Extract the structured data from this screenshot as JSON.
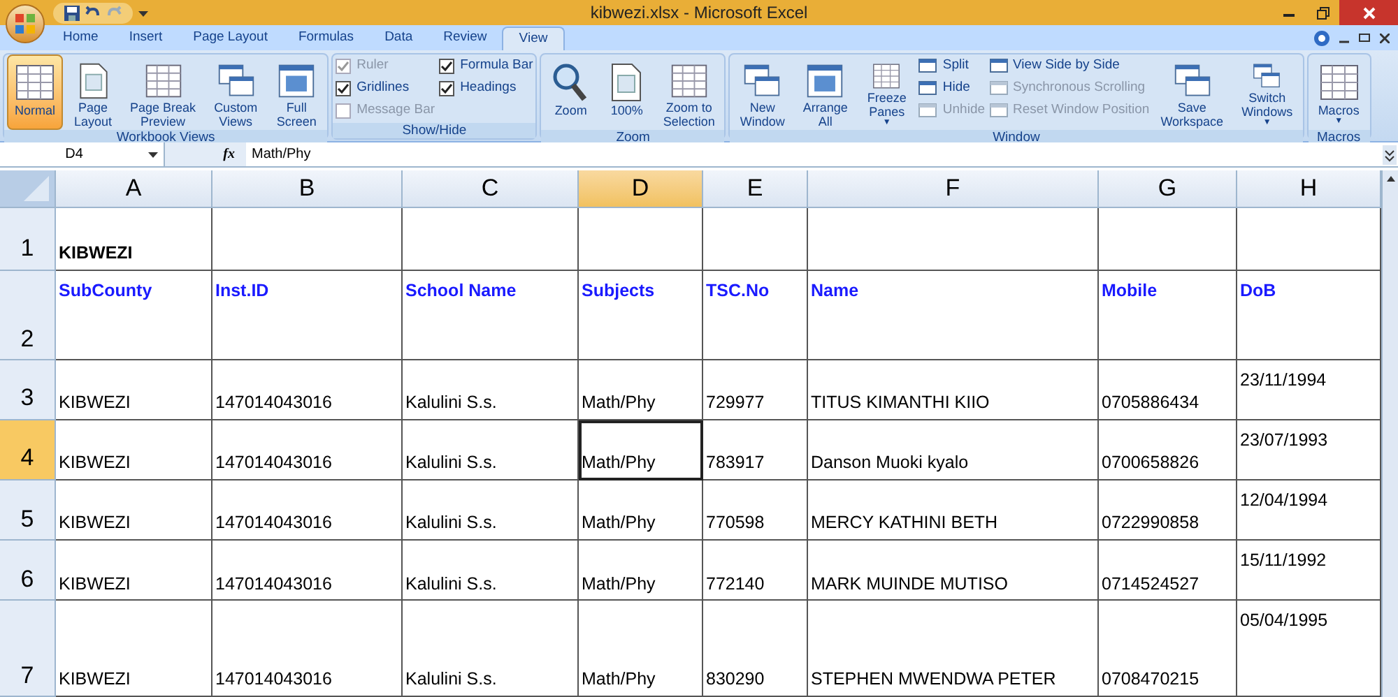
{
  "window": {
    "title": "kibwezi.xlsx - Microsoft Excel"
  },
  "tabs": [
    {
      "label": "Home",
      "selected": false
    },
    {
      "label": "Insert",
      "selected": false
    },
    {
      "label": "Page Layout",
      "selected": false
    },
    {
      "label": "Formulas",
      "selected": false
    },
    {
      "label": "Data",
      "selected": false
    },
    {
      "label": "Review",
      "selected": false
    },
    {
      "label": "View",
      "selected": true
    }
  ],
  "ribbon": {
    "groups": [
      {
        "label": "Workbook Views",
        "columns": [
          [
            {
              "kind": "large",
              "label": "Normal",
              "selected": true
            }
          ],
          [
            {
              "kind": "large",
              "label": "Page\nLayout",
              "selected": false
            }
          ],
          [
            {
              "kind": "large",
              "label": "Page Break\nPreview",
              "selected": false
            }
          ],
          [
            {
              "kind": "large",
              "label": "Custom\nViews",
              "selected": false
            }
          ],
          [
            {
              "kind": "large",
              "label": "Full\nScreen",
              "selected": false
            }
          ]
        ]
      },
      {
        "label": "Show/Hide",
        "columns": [
          [
            {
              "kind": "check",
              "label": "Ruler",
              "checked": true,
              "disabled": true
            },
            {
              "kind": "check",
              "label": "Gridlines",
              "checked": true,
              "disabled": false
            },
            {
              "kind": "check",
              "label": "Message Bar",
              "checked": false,
              "disabled": true
            }
          ],
          [
            {
              "kind": "check",
              "label": "Formula Bar",
              "checked": true,
              "disabled": false
            },
            {
              "kind": "check",
              "label": "Headings",
              "checked": true,
              "disabled": false
            }
          ]
        ]
      },
      {
        "label": "Zoom",
        "columns": [
          [
            {
              "kind": "large",
              "label": "Zoom",
              "selected": false
            }
          ],
          [
            {
              "kind": "large",
              "label": "100%",
              "selected": false
            }
          ],
          [
            {
              "kind": "large",
              "label": "Zoom to\nSelection",
              "selected": false
            }
          ]
        ]
      },
      {
        "label": "Window",
        "columns": [
          [
            {
              "kind": "large",
              "label": "New\nWindow",
              "selected": false
            }
          ],
          [
            {
              "kind": "large",
              "label": "Arrange\nAll",
              "selected": false
            }
          ],
          [
            {
              "kind": "large",
              "label": "Freeze\nPanes",
              "selected": false,
              "caret": "▼"
            }
          ],
          [
            {
              "kind": "small",
              "label": "Split",
              "disabled": false
            },
            {
              "kind": "small",
              "label": "Hide",
              "disabled": false
            },
            {
              "kind": "small",
              "label": "Unhide",
              "disabled": true
            }
          ],
          [
            {
              "kind": "small",
              "label": "View Side by Side",
              "disabled": false
            },
            {
              "kind": "small",
              "label": "Synchronous Scrolling",
              "disabled": true
            },
            {
              "kind": "small",
              "label": "Reset Window Position",
              "disabled": true
            }
          ],
          [
            {
              "kind": "large",
              "label": "Save\nWorkspace",
              "selected": false
            }
          ],
          [
            {
              "kind": "large",
              "label": "Switch\nWindows",
              "selected": false,
              "caret": "▼"
            }
          ]
        ]
      },
      {
        "label": "Macros",
        "columns": [
          [
            {
              "kind": "large",
              "label": "Macros",
              "selected": false,
              "caret": "▼"
            }
          ]
        ]
      }
    ]
  },
  "formula_bar": {
    "name_box": "D4",
    "fx": "fx",
    "formula": "Math/Phy"
  },
  "sheet": {
    "columns": [
      {
        "label": "A",
        "selected": false
      },
      {
        "label": "B",
        "selected": false
      },
      {
        "label": "C",
        "selected": false
      },
      {
        "label": "D",
        "selected": true
      },
      {
        "label": "E",
        "selected": false
      },
      {
        "label": "F",
        "selected": false
      },
      {
        "label": "G",
        "selected": false
      },
      {
        "label": "H",
        "selected": false
      }
    ],
    "rows": [
      {
        "header": "1",
        "selected": false,
        "kind": "title",
        "cells": [
          "KIBWEZI",
          "",
          "",
          "",
          "",
          "",
          "",
          ""
        ]
      },
      {
        "header": "2",
        "selected": false,
        "kind": "heading",
        "cells": [
          "SubCounty",
          "Inst.ID",
          "School Name",
          "Subjects",
          "TSC.No",
          "Name",
          "Mobile",
          "DoB"
        ]
      },
      {
        "header": "3",
        "selected": false,
        "kind": "data",
        "cells": [
          "KIBWEZI",
          "147014043016",
          "Kalulini S.s.",
          "Math/Phy",
          "729977",
          "TITUS KIMANTHI KIIO",
          "0705886434",
          "23/11/1994"
        ]
      },
      {
        "header": "4",
        "selected": true,
        "kind": "data",
        "cells": [
          "KIBWEZI",
          "147014043016",
          "Kalulini S.s.",
          "Math/Phy",
          "783917",
          "Danson Muoki kyalo",
          "0700658826",
          "23/07/1993"
        ]
      },
      {
        "header": "5",
        "selected": false,
        "kind": "data",
        "cells": [
          "KIBWEZI",
          "147014043016",
          "Kalulini S.s.",
          "Math/Phy",
          "770598",
          "MERCY KATHINI BETH",
          "0722990858",
          "12/04/1994"
        ]
      },
      {
        "header": "6",
        "selected": false,
        "kind": "data",
        "cells": [
          "KIBWEZI",
          "147014043016",
          "Kalulini S.s.",
          "Math/Phy",
          "772140",
          "MARK MUINDE MUTISO",
          "0714524527",
          "15/11/1992"
        ]
      },
      {
        "header": "7",
        "selected": false,
        "kind": "data",
        "cells": [
          "KIBWEZI",
          "147014043016",
          "Kalulini S.s.",
          "Math/Phy",
          "830290",
          "STEPHEN MWENDWA PETER",
          "0708470215",
          "05/04/1995"
        ]
      }
    ]
  }
}
